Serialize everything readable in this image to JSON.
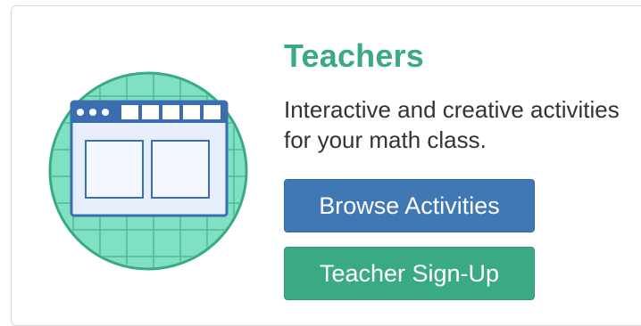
{
  "card": {
    "title": "Teachers",
    "description": "Interactive and creative activities for your math class.",
    "illustration_icon": "activity-window-icon"
  },
  "buttons": {
    "browse_label": "Browse Activities",
    "signup_label": "Teacher Sign-Up"
  },
  "colors": {
    "accent_green": "#3aaa84",
    "primary_blue": "#3f78b5",
    "illustration_teal": "#7fe0c4",
    "window_blue": "#3b6db0",
    "window_panel": "#dfe8f8"
  }
}
